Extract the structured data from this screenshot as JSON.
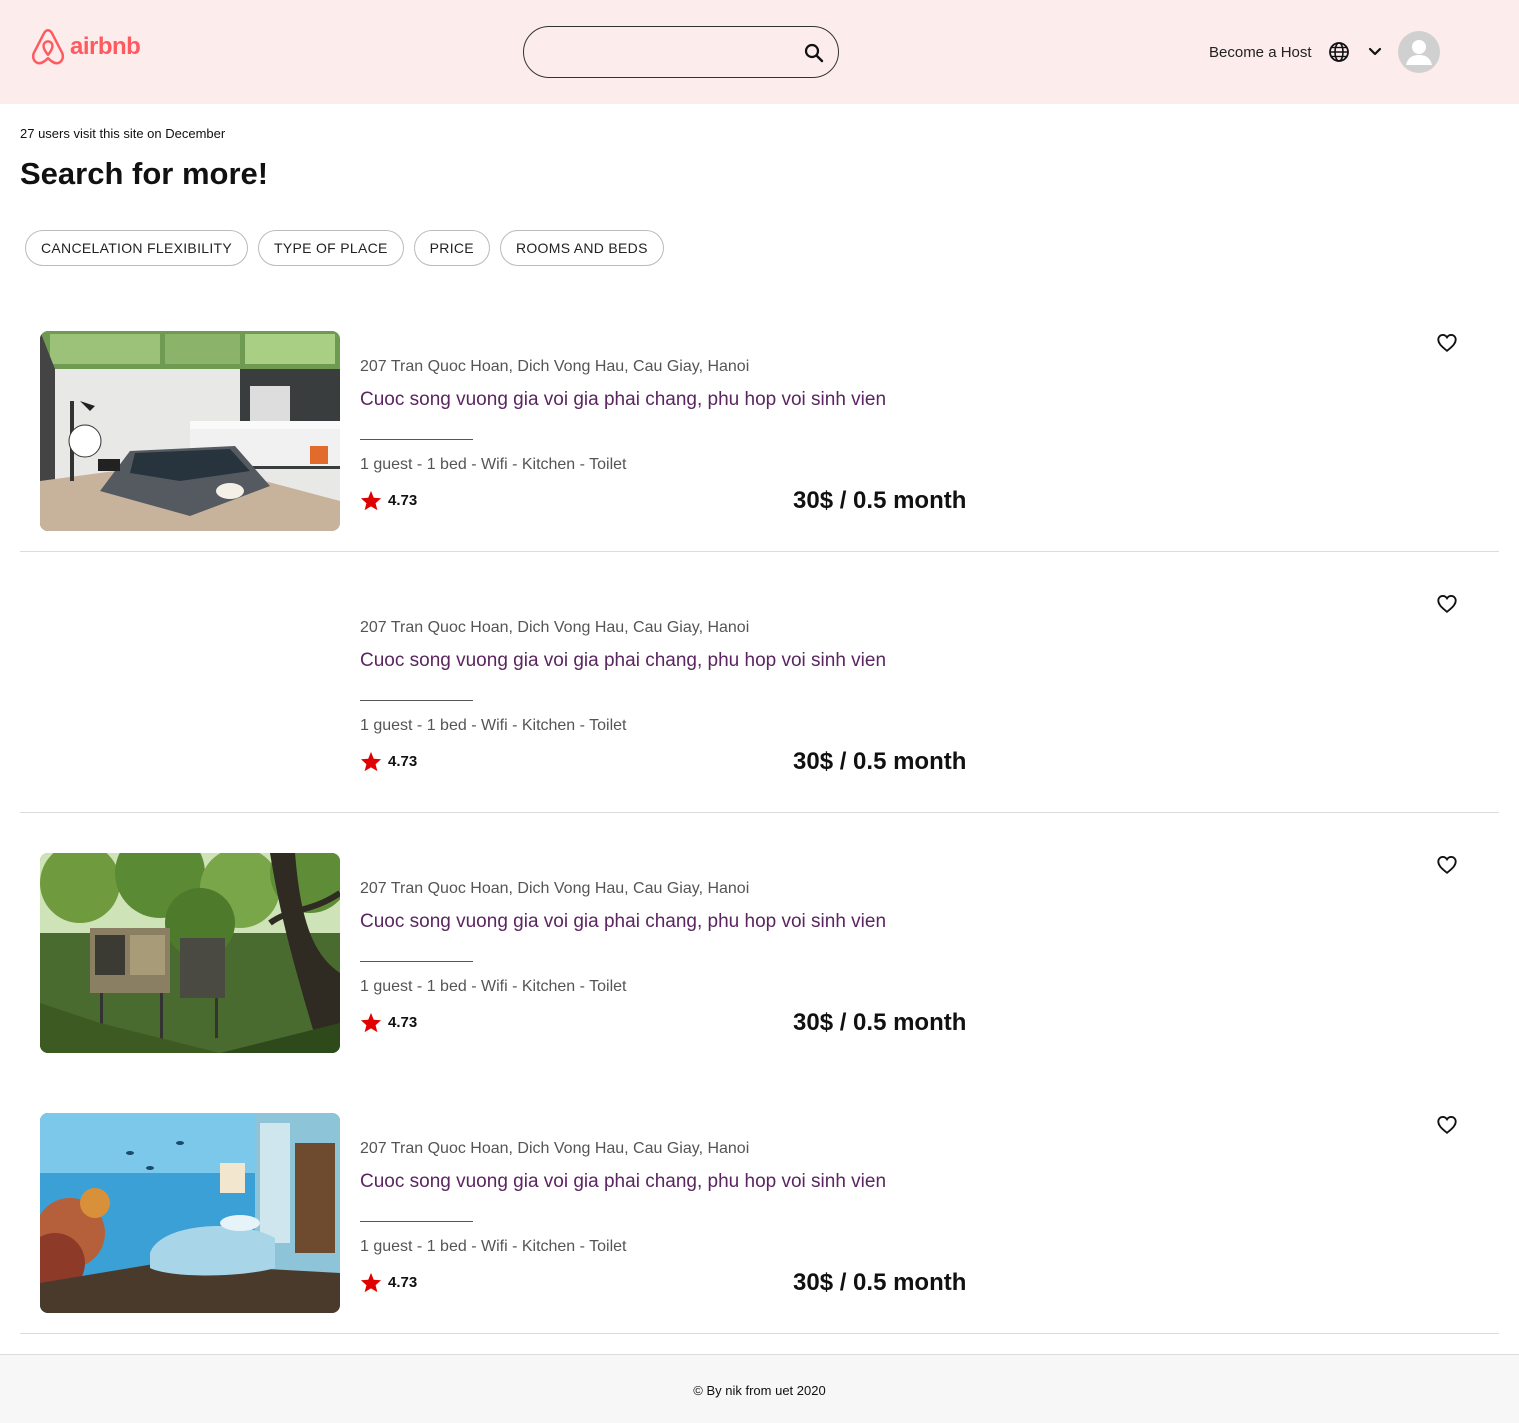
{
  "header": {
    "logo_text": "airbnb",
    "search_placeholder": "",
    "become_host": "Become a Host"
  },
  "intro": {
    "visit_text": "27 users visit this site on December",
    "heading": "Search for more!"
  },
  "filters": [
    "CANCELATION FLEXIBILITY",
    "TYPE OF PLACE",
    "PRICE",
    "ROOMS AND BEDS"
  ],
  "listings": [
    {
      "address": "207 Tran Quoc Hoan, Dich Vong Hau, Cau Giay, Hanoi",
      "title": "Cuoc song vuong gia voi gia phai chang, phu hop voi sinh vien",
      "amenities": "1 guest - 1 bed - Wifi - Kitchen - Toilet",
      "rating": "4.73",
      "price": "30$ / 0.5 month",
      "image": "modern-bedroom"
    },
    {
      "address": "207 Tran Quoc Hoan, Dich Vong Hau, Cau Giay, Hanoi",
      "title": "Cuoc song vuong gia voi gia phai chang, phu hop voi sinh vien",
      "amenities": "1 guest - 1 bed - Wifi - Kitchen - Toilet",
      "rating": "4.73",
      "price": "30$ / 0.5 month",
      "image": "none"
    },
    {
      "address": "207 Tran Quoc Hoan, Dich Vong Hau, Cau Giay, Hanoi",
      "title": "Cuoc song vuong gia voi gia phai chang, phu hop voi sinh vien",
      "amenities": "1 guest - 1 bed - Wifi - Kitchen - Toilet",
      "rating": "4.73",
      "price": "30$ / 0.5 month",
      "image": "treehouse"
    },
    {
      "address": "207 Tran Quoc Hoan, Dich Vong Hau, Cau Giay, Hanoi",
      "title": "Cuoc song vuong gia voi gia phai chang, phu hop voi sinh vien",
      "amenities": "1 guest - 1 bed - Wifi - Kitchen - Toilet",
      "rating": "4.73",
      "price": "30$ / 0.5 month",
      "image": "underwater-bedroom"
    }
  ],
  "footer": {
    "text": "© By nik from uet 2020"
  },
  "colors": {
    "brand": "#ff5a5f",
    "header_bg": "#fdecec",
    "title": "#5a2560",
    "star": "#e00000"
  }
}
